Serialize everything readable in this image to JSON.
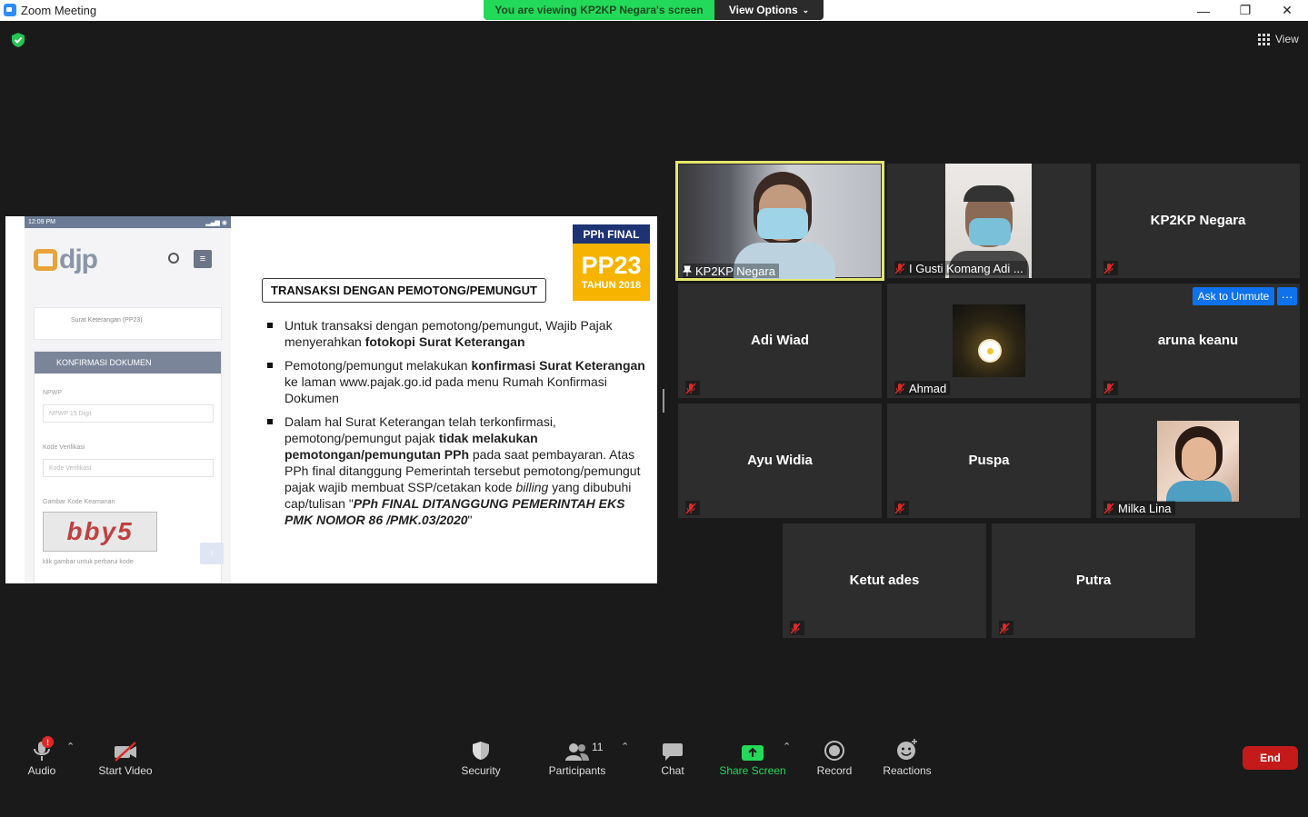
{
  "window": {
    "title": "Zoom Meeting",
    "minimize": "—",
    "restore": "❐",
    "close": "✕"
  },
  "banner": {
    "viewing": "You are viewing KP2KP Negara's screen",
    "view_options": "View Options"
  },
  "view_button": "View",
  "slide": {
    "phone": {
      "time": "12:09 PM",
      "logo": "djp",
      "breadcrumb": "Surat Keterangan (PP23)",
      "card_header": "KONFIRMASI DOKUMEN",
      "npwp_label": "NPWP",
      "npwp_placeholder": "NPWP 15 Digit",
      "kode_label": "Kode Verifikasi",
      "kode_placeholder": "Kode Verifikasi",
      "captcha_label": "Gambar Kode Keamanan",
      "captcha_text": "bby5",
      "captcha_hint": "klik gambar untuk perbarui kode"
    },
    "badge": {
      "top": "PPh FINAL",
      "big": "PP23",
      "year": "TAHUN 2018"
    },
    "title": "TRANSAKSI DENGAN PEMOTONG/PEMUNGUT",
    "b1a": "Untuk transaksi dengan pemotong/pemungut, Wajib Pajak menyerahkan ",
    "b1b": "fotokopi Surat Keterangan",
    "b2a": "Pemotong/pemungut melakukan ",
    "b2b": "konfirmasi Surat Keterangan",
    "b2c": " ke laman www.pajak.go.id pada menu Rumah Konfirmasi Dokumen",
    "b3a": "Dalam hal Surat Keterangan telah terkonfirmasi, pemotong/pemungut pajak ",
    "b3b": "tidak melakukan pemotongan/pemungutan PPh",
    "b3c": " pada saat pembayaran. Atas PPh final ditanggung Pemerintah tersebut pemotong/pemungut pajak wajib membuat SSP/cetakan kode ",
    "b3d": "billing",
    "b3e": " yang dibubuhi cap/tulisan \"",
    "b3f": "PPh FINAL DITANGGUNG PEMERINTAH EKS PMK NOMOR 86 /PMK.03/2020",
    "b3g": "\""
  },
  "participants": {
    "p1": "KP2KP Negara",
    "p2": "I Gusti Komang Adi ...",
    "p3": "KP2KP Negara",
    "p4": "Adi Wiad",
    "p5": "Ahmad",
    "p6": "aruna keanu",
    "p7": "Ayu Widia",
    "p8": "Puspa",
    "p9": "Milka Lina",
    "p10": "Ketut ades",
    "p11": "Putra"
  },
  "ask_unmute": "Ask to Unmute",
  "more_label": "···",
  "toolbar": {
    "audio": "Audio",
    "audio_badge": "!",
    "start_video": "Start Video",
    "security": "Security",
    "participants": "Participants",
    "participants_count": "11",
    "chat": "Chat",
    "share_screen": "Share Screen",
    "record": "Record",
    "reactions": "Reactions",
    "end": "End"
  },
  "colors": {
    "active_speaker": "#e5e76c",
    "share_green": "#23d959",
    "end_red": "#c51a1a",
    "unmute_blue": "#0e72ed"
  }
}
